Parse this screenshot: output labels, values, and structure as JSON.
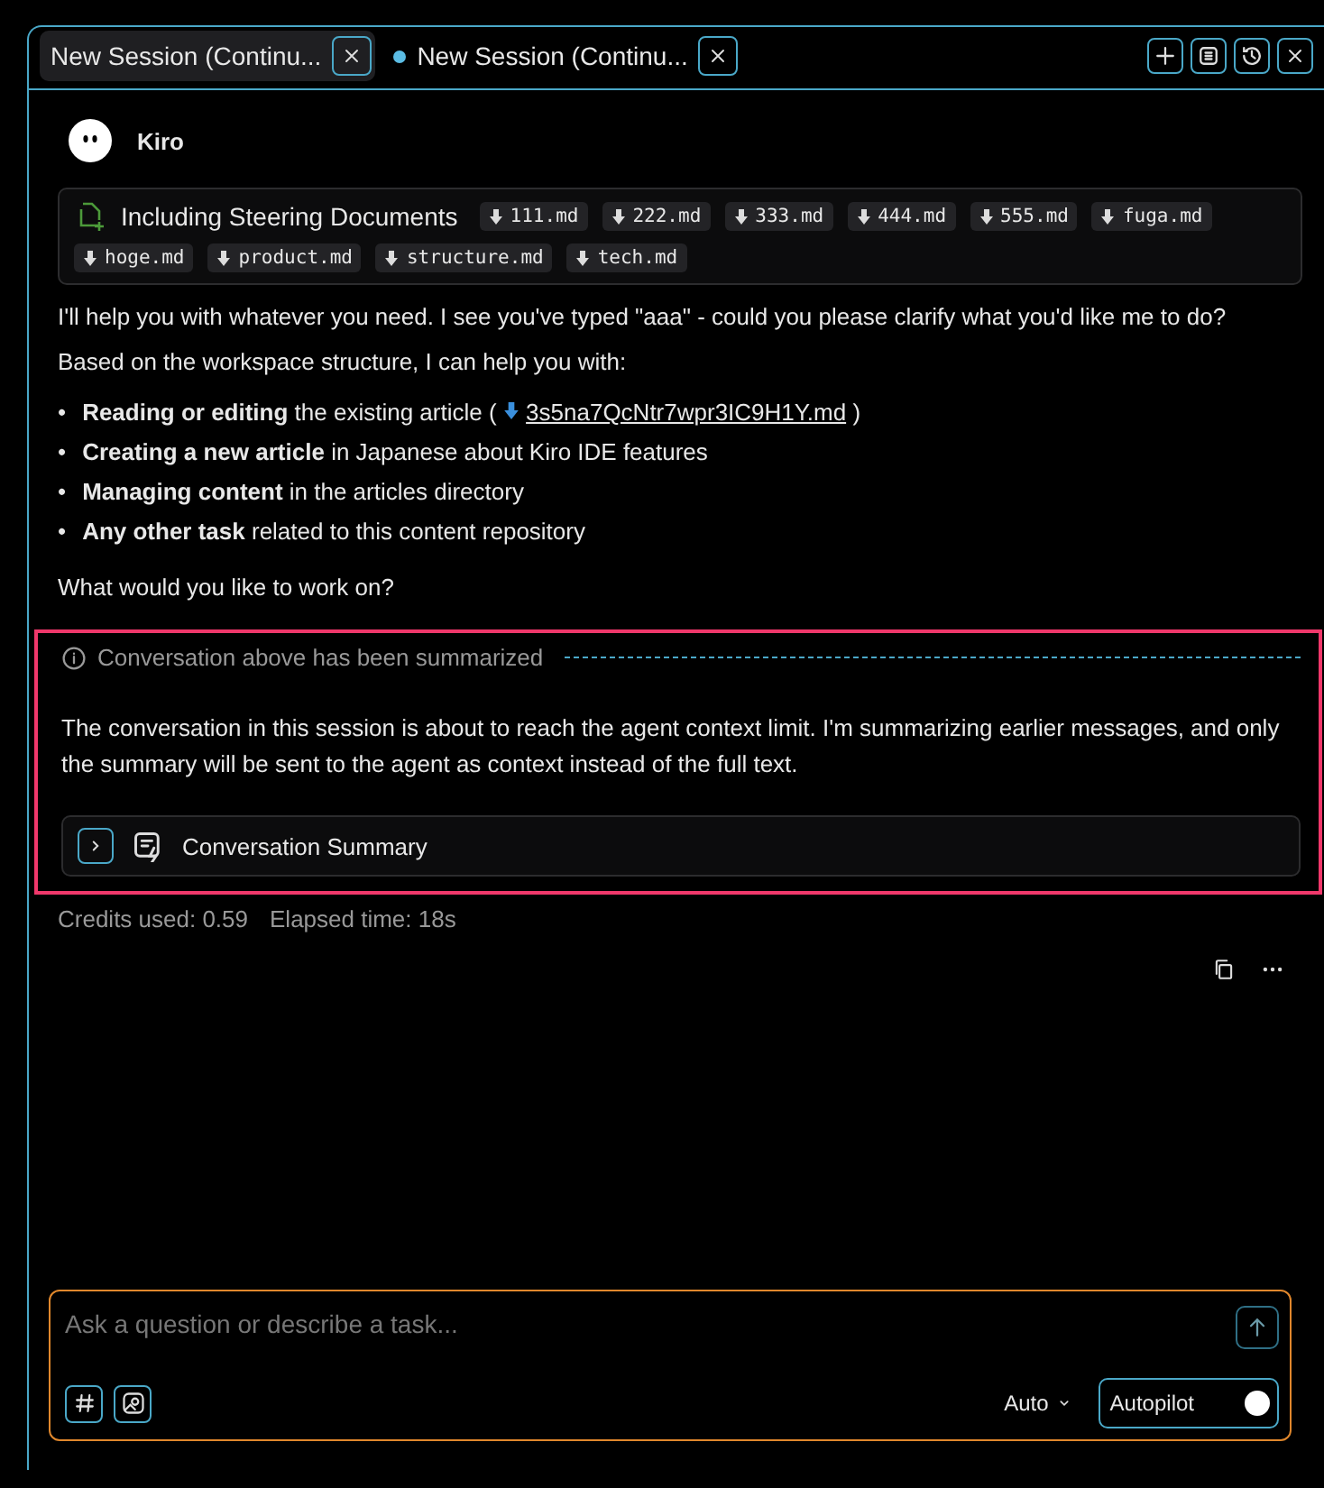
{
  "tabs": [
    {
      "label": "New Session (Continu...",
      "selected": true,
      "modified": false
    },
    {
      "label": "New Session (Continu...",
      "selected": false,
      "modified": true
    }
  ],
  "message": {
    "author": "Kiro",
    "steering": {
      "label": "Including Steering Documents",
      "files": [
        "111.md",
        "222.md",
        "333.md",
        "444.md",
        "555.md",
        "fuga.md",
        "hoge.md",
        "product.md",
        "structure.md",
        "tech.md"
      ]
    },
    "intro": "I'll help you with whatever you need. I see you've typed \"aaa\" - could you please clarify what you'd like me to do?",
    "lead": "Based on the workspace structure, I can help you with:",
    "bullets": [
      {
        "marker": "•",
        "text": "**Reading or editing** the existing article (",
        "link": "3s5na7QcNtr7wpr3IC9H1Y.md",
        "after": ")"
      },
      {
        "marker": "•",
        "text": "**Creating a new article** in Japanese about Kiro IDE features"
      },
      {
        "marker": "•",
        "text": "**Managing content** in the articles directory"
      },
      {
        "marker": "•",
        "text": "**Any other task** related to this content repository"
      }
    ],
    "question": "What would you like to work on?"
  },
  "summary": {
    "notice": "Conversation above has been summarized",
    "body": "The conversation in this session is about to reach the agent context limit. I'm summarizing earlier messages, and only the summary will be sent to the agent as context instead of the full text.",
    "title": "Conversation Summary",
    "expanded": false
  },
  "stats": [
    "Credits used: 0.59",
    "Elapsed time: 18s"
  ],
  "composer": {
    "placeholder": "Ask a question or describe a task...",
    "model": "Auto",
    "mode": {
      "label": "Autopilot",
      "on": true
    }
  }
}
